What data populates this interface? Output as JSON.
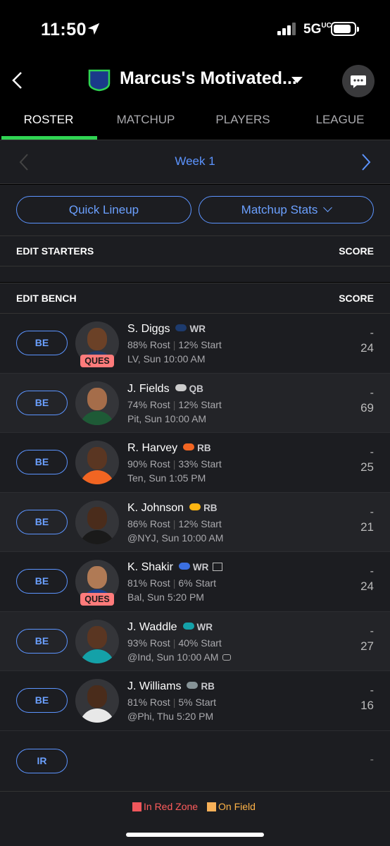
{
  "status_bar": {
    "time": "11:50",
    "network": "5G",
    "network_suffix": "UC"
  },
  "header": {
    "team_name": "Marcus's Motivated..."
  },
  "tabs": [
    {
      "label": "ROSTER",
      "active": true
    },
    {
      "label": "MATCHUP",
      "active": false
    },
    {
      "label": "PLAYERS",
      "active": false
    },
    {
      "label": "LEAGUE",
      "active": false
    }
  ],
  "week_nav": {
    "label": "Week 1"
  },
  "actions": {
    "quick_lineup": "Quick Lineup",
    "matchup_stats": "Matchup Stats"
  },
  "starters": {
    "title": "EDIT STARTERS",
    "score_label": "SCORE"
  },
  "bench": {
    "title": "EDIT BENCH",
    "score_label": "SCORE"
  },
  "players": [
    {
      "slot": "BE",
      "name": "S. Diggs",
      "team_icon": "patriots-logo",
      "team_color": "#1d3b6e",
      "position": "WR",
      "rost": "88% Rost",
      "start": "12% Start",
      "game": "LV, Sun 10:00 AM",
      "tag": "QUES",
      "score": "-",
      "projection": "24",
      "skin": "#6b4127",
      "jersey": "#223a64"
    },
    {
      "slot": "BE",
      "name": "J. Fields",
      "team_icon": "jets-logo",
      "team_color": "#cccccc",
      "position": "QB",
      "rost": "74% Rost",
      "start": "12% Start",
      "game": "Pit, Sun 10:00 AM",
      "tag": "",
      "score": "-",
      "projection": "69",
      "skin": "#a56d4a",
      "jersey": "#1e5a36"
    },
    {
      "slot": "BE",
      "name": "R. Harvey",
      "team_icon": "broncos-logo",
      "team_color": "#f26522",
      "position": "RB",
      "rost": "90% Rost",
      "start": "33% Start",
      "game": "Ten, Sun 1:05 PM",
      "tag": "",
      "score": "-",
      "projection": "25",
      "skin": "#5a3622",
      "jersey": "#f26522"
    },
    {
      "slot": "BE",
      "name": "K. Johnson",
      "team_icon": "steelers-logo",
      "team_color": "#ffb612",
      "position": "RB",
      "rost": "86% Rost",
      "start": "12% Start",
      "game": "@NYJ, Sun 10:00 AM",
      "tag": "",
      "score": "-",
      "projection": "21",
      "skin": "#4a2c1b",
      "jersey": "#1a1a1a"
    },
    {
      "slot": "BE",
      "name": "K. Shakir",
      "team_icon": "bills-logo",
      "team_color": "#3b6fe0",
      "position": "WR",
      "rost": "81% Rost",
      "start": "6% Start",
      "game": "Bal, Sun 5:20 PM",
      "tag": "QUES",
      "score": "-",
      "projection": "24",
      "news_icon": "news-icon",
      "skin": "#b07a55",
      "jersey": "#1b3f8f"
    },
    {
      "slot": "BE",
      "name": "J. Waddle",
      "team_icon": "dolphins-logo",
      "team_color": "#14a1a8",
      "position": "WR",
      "rost": "93% Rost",
      "start": "40% Start",
      "game": "@Ind, Sun 10:00 AM",
      "tag": "",
      "score": "-",
      "projection": "27",
      "weather_icon": "stadium-icon",
      "skin": "#5a3622",
      "jersey": "#14a1a8"
    },
    {
      "slot": "BE",
      "name": "J. Williams",
      "team_icon": "cowboys-logo",
      "team_color": "#869397",
      "position": "RB",
      "rost": "81% Rost",
      "start": "5% Start",
      "game": "@Phi, Thu 5:20 PM",
      "tag": "",
      "score": "-",
      "projection": "16",
      "skin": "#4a2c1b",
      "jersey": "#e8e8e8"
    }
  ],
  "ir": {
    "slot": "IR",
    "score": "-"
  },
  "legend": {
    "red_zone": "In Red Zone",
    "on_field": "On Field"
  }
}
